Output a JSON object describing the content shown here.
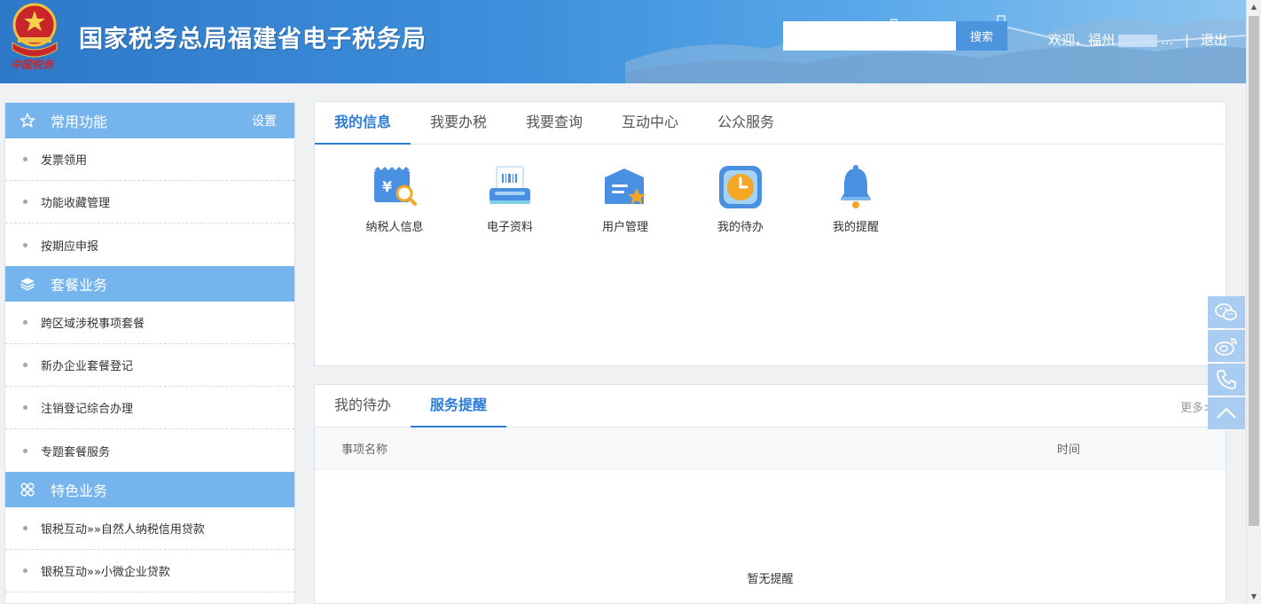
{
  "header": {
    "title": "国家税务总局福建省电子税务局",
    "search_placeholder": "",
    "search_button": "搜索",
    "welcome": "欢迎，福州",
    "welcome_ellipsis": "...",
    "separator": "|",
    "logout": "退出",
    "emblem_caption": "中国税务",
    "bg_color": "#3d8edb"
  },
  "sidebar": {
    "sections": [
      {
        "title": "常用功能",
        "icon": "star-icon",
        "setting": "设置",
        "items": [
          "发票领用",
          "功能收藏管理",
          "按期应申报"
        ]
      },
      {
        "title": "套餐业务",
        "icon": "layers-icon",
        "items": [
          "跨区域涉税事项套餐",
          "新办企业套餐登记",
          "注销登记综合办理",
          "专题套餐服务"
        ]
      },
      {
        "title": "特色业务",
        "icon": "grid-icon",
        "items": [
          "银税互动»»自然人纳税信用贷款",
          "银税互动»»小微企业贷款"
        ]
      }
    ],
    "head_color": "#76b4ee"
  },
  "main": {
    "tabs": [
      "我的信息",
      "我要办税",
      "我要查询",
      "互动中心",
      "公众服务"
    ],
    "active_tab": 0,
    "icons": [
      {
        "label": "纳税人信息",
        "icon": "taxpayer-info-icon"
      },
      {
        "label": "电子资料",
        "icon": "electronic-data-icon"
      },
      {
        "label": "用户管理",
        "icon": "user-management-icon"
      },
      {
        "label": "我的待办",
        "icon": "todo-clock-icon"
      },
      {
        "label": "我的提醒",
        "icon": "bell-icon"
      }
    ],
    "accent_color": "#2d7cd6"
  },
  "bottom": {
    "tabs": [
      "我的待办",
      "服务提醒"
    ],
    "active_tab": 1,
    "more": "更多>",
    "columns": [
      "事项名称",
      "时间"
    ],
    "empty_text": "暂无提醒"
  },
  "float_tools": [
    "wechat-icon",
    "weibo-icon",
    "phone-icon",
    "back-to-top-icon"
  ]
}
